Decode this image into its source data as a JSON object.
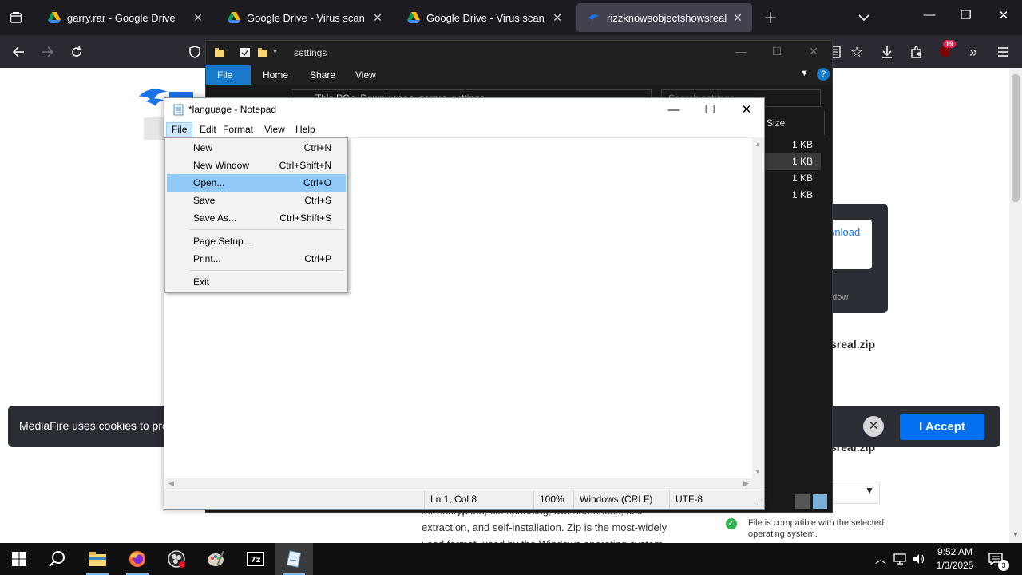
{
  "browser": {
    "tabs": [
      {
        "title": "garry.rar - Google Drive",
        "active": false
      },
      {
        "title": "Google Drive - Virus scan warning",
        "active": false
      },
      {
        "title": "Google Drive - Virus scan warning",
        "active": false
      },
      {
        "title": "rizzknowsobjectshowsreal",
        "active": true
      }
    ],
    "extension_badge": "19"
  },
  "web": {
    "download_label": "wnload",
    "download_sub": "ndow",
    "filename": "sreal.zip",
    "filename_repeat": "sreal.zip",
    "cookie_text": "MediaFire uses cookies to prov",
    "cookie_accept": "I Accept",
    "compat_text": "File is compatible with the selected operating system.",
    "body_lines": [
      "for encryption, file spanning, awesomeness, self-",
      "extraction, and self-installation. Zip is the most-widely",
      "used format, used by the Windows operating system"
    ]
  },
  "explorer": {
    "title": "settings",
    "ribbon_tabs": [
      "File",
      "Home",
      "Share",
      "View"
    ],
    "breadcrumb": [
      "This PC",
      "Downloads",
      "garry",
      "settings"
    ],
    "search_placeholder": "Search settings",
    "size_header": "Size",
    "sizes": [
      "1 KB",
      "1 KB",
      "1 KB",
      "1 KB"
    ]
  },
  "notepad": {
    "title": "*language - Notepad",
    "menu": [
      "File",
      "Edit",
      "Format",
      "View",
      "Help"
    ],
    "status": {
      "position": "Ln 1, Col 8",
      "zoom": "100%",
      "line_ending": "Windows (CRLF)",
      "encoding": "UTF-8"
    }
  },
  "file_menu": {
    "items": [
      {
        "label": "New",
        "shortcut": "Ctrl+N"
      },
      {
        "label": "New Window",
        "shortcut": "Ctrl+Shift+N"
      },
      {
        "label": "Open...",
        "shortcut": "Ctrl+O"
      },
      {
        "label": "Save",
        "shortcut": "Ctrl+S"
      },
      {
        "label": "Save As...",
        "shortcut": "Ctrl+Shift+S"
      },
      {
        "label": "Page Setup...",
        "shortcut": ""
      },
      {
        "label": "Print...",
        "shortcut": "Ctrl+P"
      },
      {
        "label": "Exit",
        "shortcut": ""
      }
    ],
    "highlighted_index": 2
  },
  "taskbar": {
    "time": "9:52 AM",
    "date": "1/3/2025",
    "notification_count": "3"
  },
  "colors": {
    "accent_blue": "#0070f0",
    "menu_highlight": "#91c9f7",
    "explorer_file_tab": "#1979ca"
  }
}
